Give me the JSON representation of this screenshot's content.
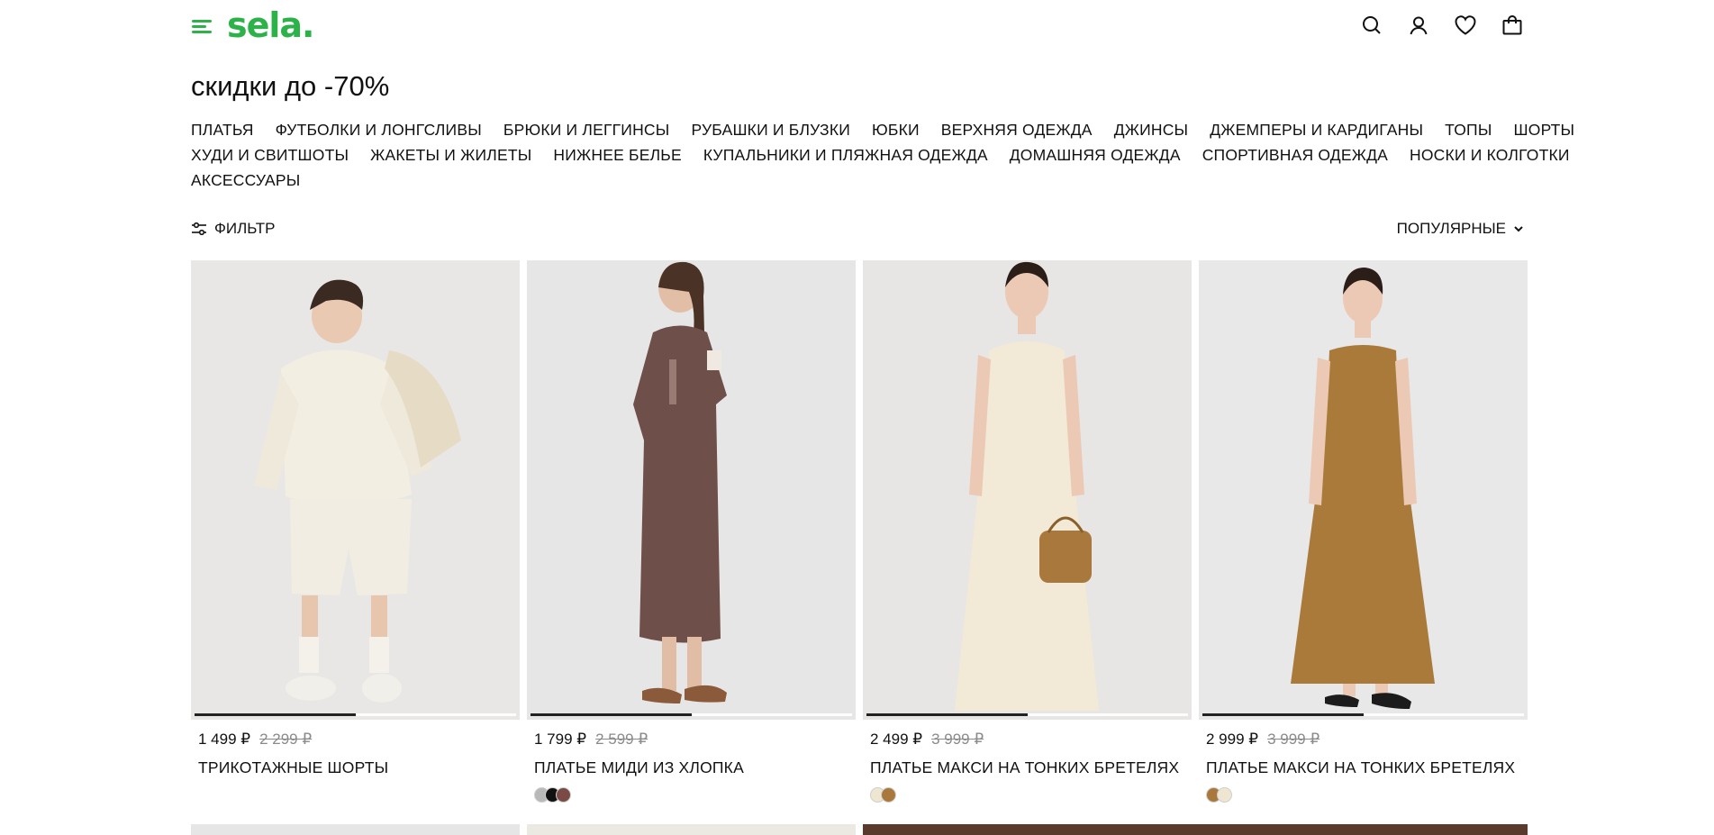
{
  "header": {
    "logo": "sela.",
    "icons": [
      "search-icon",
      "user-icon",
      "heart-icon",
      "bag-icon"
    ]
  },
  "page_title": "скидки до -70%",
  "categories": {
    "row1": [
      "ПЛАТЬЯ",
      "ФУТБОЛКИ И ЛОНГСЛИВЫ",
      "БРЮКИ И ЛЕГГИНСЫ",
      "РУБАШКИ И БЛУЗКИ",
      "ЮБКИ",
      "ВЕРХНЯЯ ОДЕЖДА",
      "ДЖИНСЫ",
      "ДЖЕМПЕРЫ И КАРДИГАНЫ",
      "ТОПЫ",
      "ШОРТЫ"
    ],
    "row2": [
      "ХУДИ И СВИТШОТЫ",
      "ЖАКЕТЫ И ЖИЛЕТЫ",
      "НИЖНЕЕ БЕЛЬЕ",
      "КУПАЛЬНИКИ И ПЛЯЖНАЯ ОДЕЖДА",
      "ДОМАШНЯЯ ОДЕЖДА",
      "СПОРТИВНАЯ ОДЕЖДА",
      "НОСКИ И КОЛГОТКИ"
    ],
    "row3": [
      "АКСЕССУАРЫ"
    ]
  },
  "toolbar": {
    "filter_label": "ФИЛЬТР",
    "sort_label": "ПОПУЛЯРНЫЕ"
  },
  "products": [
    {
      "price": "1 499 ₽",
      "old_price": "2 299 ₽",
      "name": "ТРИКОТАЖНЫЕ ШОРТЫ",
      "swatches": [],
      "gallery_progress": 0.5,
      "garment_color": "#f1ebdd",
      "bg": "#e8e7e5"
    },
    {
      "price": "1 799 ₽",
      "old_price": "2 599 ₽",
      "name": "ПЛАТЬЕ МИДИ ИЗ ХЛОПКА",
      "swatches": [
        "#b9b9b9",
        "#111111",
        "#7a4a45"
      ],
      "gallery_progress": 0.5,
      "garment_color": "#6f4f4a",
      "bg": "#e6e6e6"
    },
    {
      "price": "2 499 ₽",
      "old_price": "3 999 ₽",
      "name": "ПЛАТЬЕ МАКСИ НА ТОНКИХ БРЕТЕЛЯХ",
      "swatches": [
        "#efe6d2",
        "#a8783c"
      ],
      "gallery_progress": 0.5,
      "garment_color": "#f2ead6",
      "bg": "#e7e6e4"
    },
    {
      "price": "2 999 ₽",
      "old_price": "3 999 ₽",
      "name": "ПЛАТЬЕ МАКСИ НА ТОНКИХ БРЕТЕЛЯХ",
      "swatches": [
        "#a8783c",
        "#efe6d2"
      ],
      "gallery_progress": 0.5,
      "garment_color": "#a97a3a",
      "bg": "#e8e8e8"
    }
  ],
  "colors": {
    "brand": "#2db24a"
  }
}
